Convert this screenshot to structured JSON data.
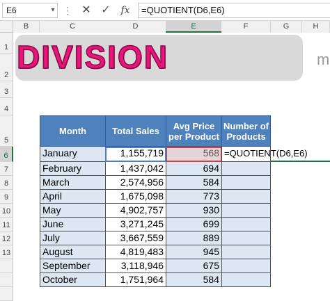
{
  "formula_bar": {
    "name_box": "E6",
    "dots": "⋮",
    "cancel_icon": "✕",
    "enter_icon": "✓",
    "fx_label": "fx",
    "formula": "=QUOTIENT(D6,E6)"
  },
  "columns": [
    "B",
    "C",
    "D",
    "E",
    "F",
    "G",
    "H"
  ],
  "rows": [
    "1",
    "2",
    "3",
    "4",
    "5",
    "6",
    "7",
    "8",
    "9",
    "10",
    "11",
    "12",
    "13"
  ],
  "banner": {
    "title": "DIVISION",
    "hint": "m"
  },
  "table": {
    "headers": {
      "month": "Month",
      "sales": "Total Sales",
      "price": "Avg Price per Product",
      "products": "Number of Products"
    },
    "rows": [
      {
        "month": "January",
        "sales": "1,155,719",
        "price": "568",
        "products": "=QUOTIENT(D6,E6)"
      },
      {
        "month": "February",
        "sales": "1,437,042",
        "price": "694",
        "products": ""
      },
      {
        "month": "March",
        "sales": "2,574,956",
        "price": "584",
        "products": ""
      },
      {
        "month": "April",
        "sales": "1,675,098",
        "price": "773",
        "products": ""
      },
      {
        "month": "May",
        "sales": "4,902,757",
        "price": "930",
        "products": ""
      },
      {
        "month": "June",
        "sales": "3,271,245",
        "price": "699",
        "products": ""
      },
      {
        "month": "July",
        "sales": "3,667,559",
        "price": "889",
        "products": ""
      },
      {
        "month": "August",
        "sales": "4,819,483",
        "price": "945",
        "products": ""
      },
      {
        "month": "September",
        "sales": "3,118,946",
        "price": "675",
        "products": ""
      },
      {
        "month": "October",
        "sales": "1,751,964",
        "price": "584",
        "products": ""
      }
    ]
  },
  "colors": {
    "header_fill": "#4f81bd",
    "band_fill": "#dde7f3",
    "title_color": "#e8157a",
    "excel_green": "#217346"
  }
}
